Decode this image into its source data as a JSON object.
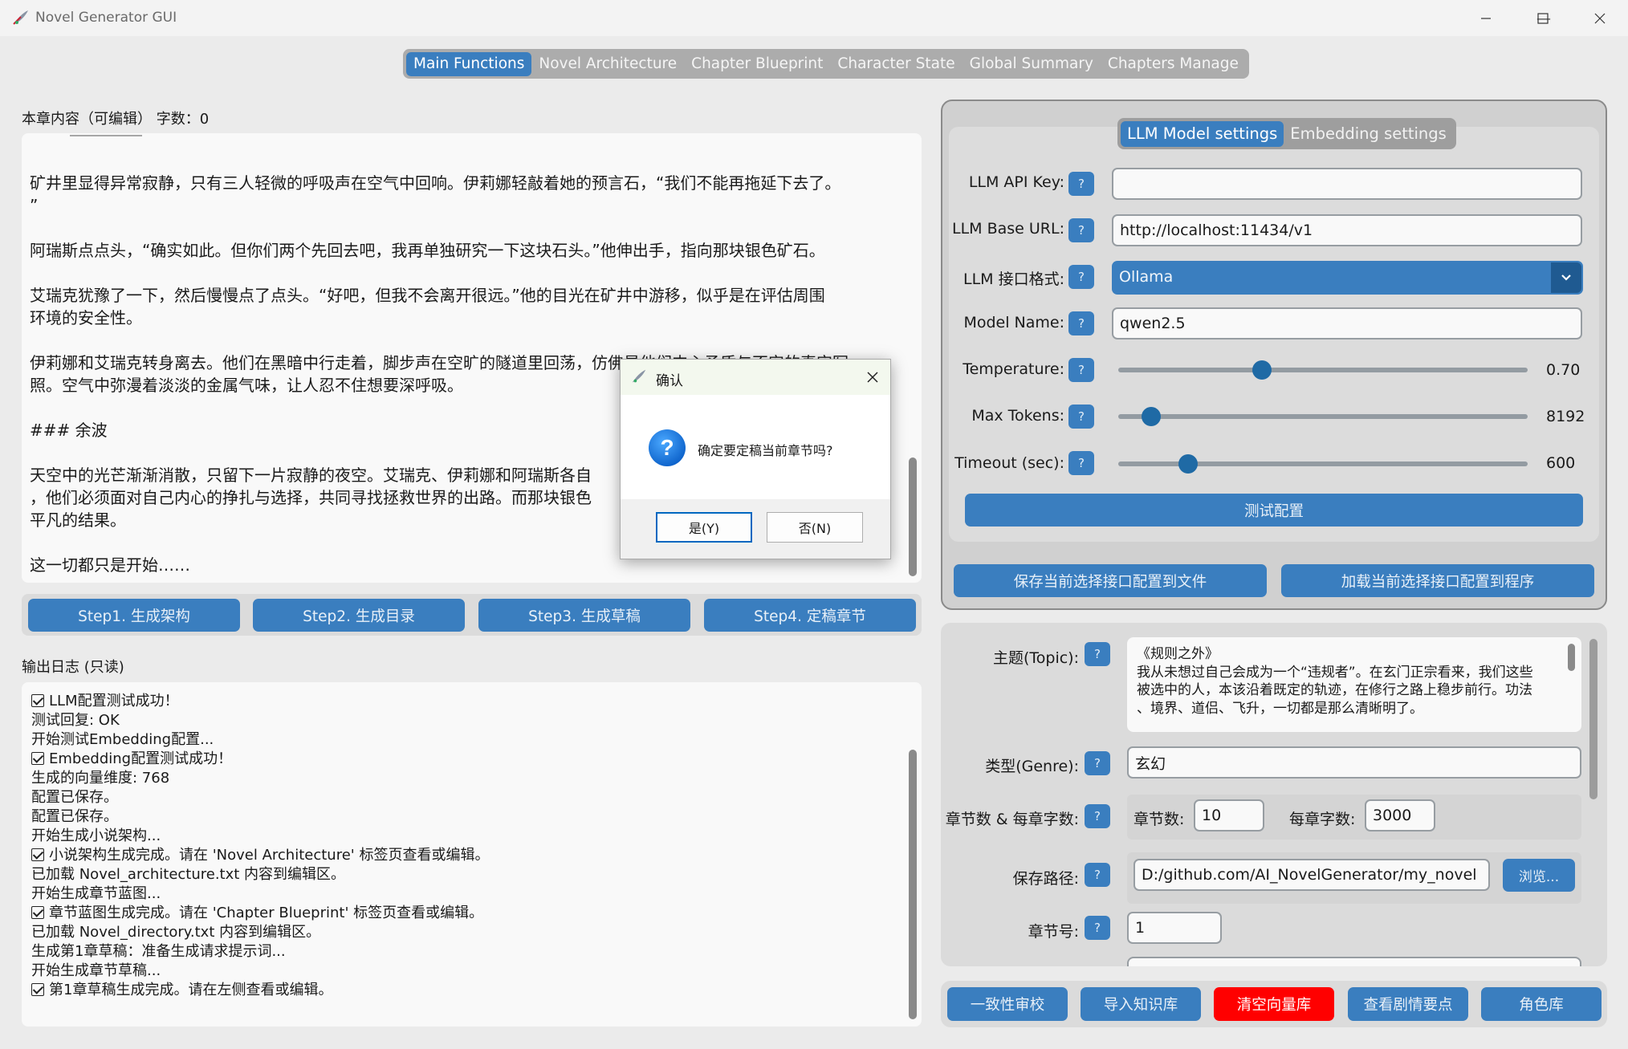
{
  "window": {
    "title": "Novel Generator GUI"
  },
  "main_tabs": [
    {
      "label": "Main Functions",
      "active": true
    },
    {
      "label": "Novel Architecture",
      "active": false
    },
    {
      "label": "Chapter Blueprint",
      "active": false
    },
    {
      "label": "Character State",
      "active": false
    },
    {
      "label": "Global Summary",
      "active": false
    },
    {
      "label": "Chapters Manage",
      "active": false
    }
  ],
  "editor": {
    "label": "本章内容（可编辑）  字数：0",
    "paragraphs": [
      "矿井里显得异常寂静，只有三人轻微的呼吸声在空气中回响。伊莉娜轻敲着她的预言石，“我们不能再拖延下去了。\n”",
      "阿瑞斯点点头，“确实如此。但你们两个先回去吧，我再单独研究一下这块石头。”他伸出手，指向那块银色矿石。",
      "艾瑞克犹豫了一下，然后慢慢点了点头。“好吧，但我不会离开很远。”他的目光在矿井中游移，似乎是在评估周围\n环境的安全性。",
      "伊莉娜和艾瑞克转身离去。他们在黑暗中行走着，脚步声在空旷的隧道里回荡，仿佛是他们内心矛盾与不安的真实写\n照。空气中弥漫着淡淡的金属气味，让人忍不住想要深呼吸。",
      "### 余波",
      "天空中的光芒渐渐消散，只留下一片寂静的夜空。艾瑞克、伊莉娜和阿瑞斯各自\n，他们必须面对自己内心的挣扎与选择，共同寻找拯救世界的出路。而那块银色\n平凡的结果。",
      "这一切都只是开始……"
    ]
  },
  "steps": {
    "step1": "Step1. 生成架构",
    "step2": "Step2. 生成目录",
    "step3": "Step3. 生成草稿",
    "step4": "Step4. 定稿章节"
  },
  "log": {
    "label": "输出日志 (只读)",
    "lines": [
      {
        "text": "LLM配置测试成功！",
        "check": true
      },
      {
        "text": "测试回复: OK",
        "check": false
      },
      {
        "text": "开始测试Embedding配置...",
        "check": false
      },
      {
        "text": "Embedding配置测试成功！",
        "check": true
      },
      {
        "text": "生成的向量维度: 768",
        "check": false
      },
      {
        "text": "配置已保存。",
        "check": false
      },
      {
        "text": "配置已保存。",
        "check": false
      },
      {
        "text": "开始生成小说架构...",
        "check": false
      },
      {
        "text": "小说架构生成完成。请在 'Novel Architecture' 标签页查看或编辑。",
        "check": true
      },
      {
        "text": "已加载 Novel_architecture.txt 内容到编辑区。",
        "check": false
      },
      {
        "text": "开始生成章节蓝图...",
        "check": false
      },
      {
        "text": "章节蓝图生成完成。请在 'Chapter Blueprint' 标签页查看或编辑。",
        "check": true
      },
      {
        "text": "已加载 Novel_directory.txt 内容到编辑区。",
        "check": false
      },
      {
        "text": "生成第1章草稿：准备生成请求提示词...",
        "check": false
      },
      {
        "text": "开始生成章节草稿...",
        "check": false
      },
      {
        "text": "第1章草稿生成完成。请在左侧查看或编辑。",
        "check": true
      }
    ]
  },
  "settings_tabs": [
    {
      "label": "LLM Model settings",
      "active": true
    },
    {
      "label": "Embedding settings",
      "active": false
    }
  ],
  "llm": {
    "api_key_label": "LLM API Key:",
    "api_key_value": "",
    "base_url_label": "LLM Base URL:",
    "base_url_value": "http://localhost:11434/v1",
    "interface_label": "LLM 接口格式:",
    "interface_value": "Ollama",
    "model_label": "Model Name:",
    "model_value": "qwen2.5",
    "temperature_label": "Temperature:",
    "temperature_value": "0.70",
    "temperature_fraction": 0.35,
    "max_tokens_label": "Max Tokens:",
    "max_tokens_value": "8192",
    "max_tokens_fraction": 0.08,
    "timeout_label": "Timeout (sec):",
    "timeout_value": "600",
    "timeout_fraction": 0.17,
    "test_button": "测试配置",
    "help": "?"
  },
  "config_buttons": {
    "save": "保存当前选择接口配置到文件",
    "load": "加载当前选择接口配置到程序"
  },
  "novel": {
    "topic_label": "主题(Topic):",
    "topic_value": "《规则之外》\n我从未想过自己会成为一个“违规者”。在玄门正宗看来，我们这些\n被选中的人，本该沿着既定的轨迹，在修行之路上稳步前行。功法\n、境界、道侣、飞升，一切都是那么清晰明了。",
    "genre_label": "类型(Genre):",
    "genre_value": "玄幻",
    "chapters_label": "章节数 & 每章字数:",
    "num_chapters_label": "章节数:",
    "num_chapters_value": "10",
    "words_label": "每章字数:",
    "words_value": "3000",
    "path_label": "保存路径:",
    "path_value": "D:/github.com/AI_NovelGenerator/my_novel",
    "browse": "浏览...",
    "chapter_num_label": "章节号:",
    "chapter_num_value": "1"
  },
  "bottom_buttons": {
    "consistency": "一致性审校",
    "import_kb": "导入知识库",
    "clear_vector": "清空向量库",
    "plot_points": "查看剧情要点",
    "characters": "角色库"
  },
  "dialog": {
    "title": "确认",
    "message": "确定要定稿当前章节吗?",
    "yes": "是(Y)",
    "no": "否(N)"
  },
  "colors": {
    "accent": "#3a7ebf",
    "danger": "#ff0000",
    "panel": "#dbdbdb",
    "background": "#ebebeb"
  }
}
